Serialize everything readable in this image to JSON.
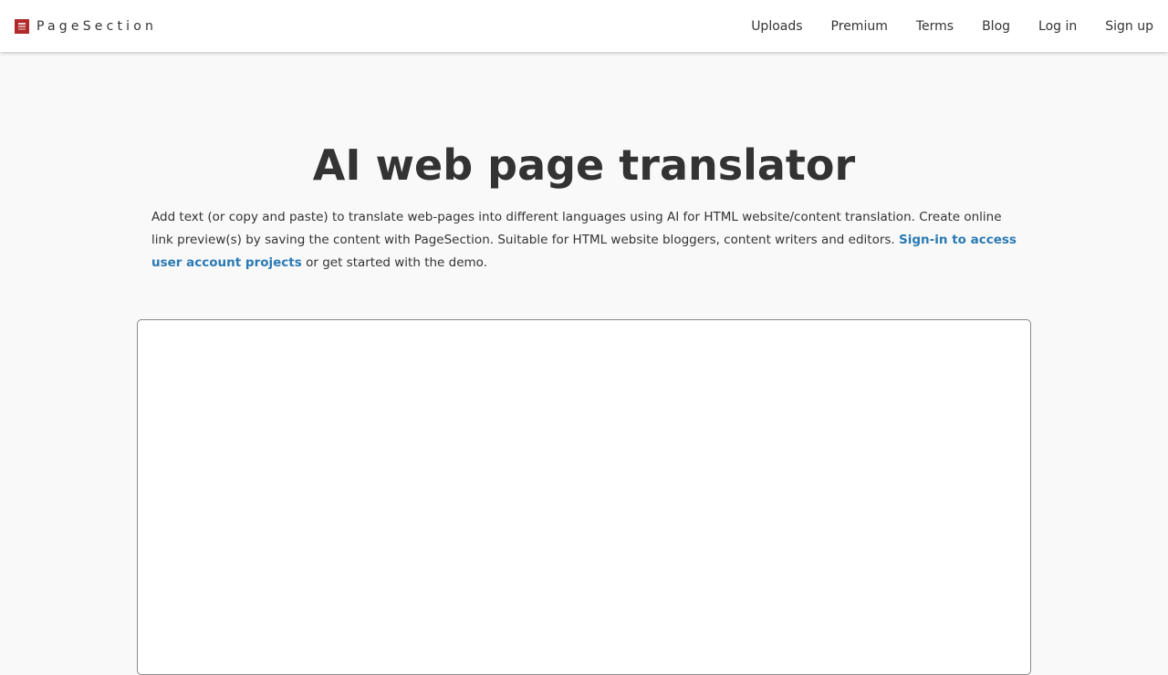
{
  "nav": {
    "brand": "PageSection",
    "links": [
      {
        "label": "Uploads"
      },
      {
        "label": "Premium"
      },
      {
        "label": "Terms"
      },
      {
        "label": "Blog"
      },
      {
        "label": "Log in"
      },
      {
        "label": "Sign up"
      }
    ]
  },
  "hero": {
    "title": "AI web page translator",
    "intro_text": "Add text (or copy and paste) to translate web-pages into different languages using AI for HTML website/content translation. Create online link preview(s) by saving the content with PageSection. Suitable for HTML website bloggers, content writers and editors.",
    "signin_link": "Sign-in to access user account projects",
    "intro_suffix": "or get started with the demo."
  },
  "editor": {
    "value": ""
  },
  "colors": {
    "accent_link": "#2a7ab5",
    "brand_logo": "#b02a2a",
    "page_bg": "#f9f9f9"
  }
}
